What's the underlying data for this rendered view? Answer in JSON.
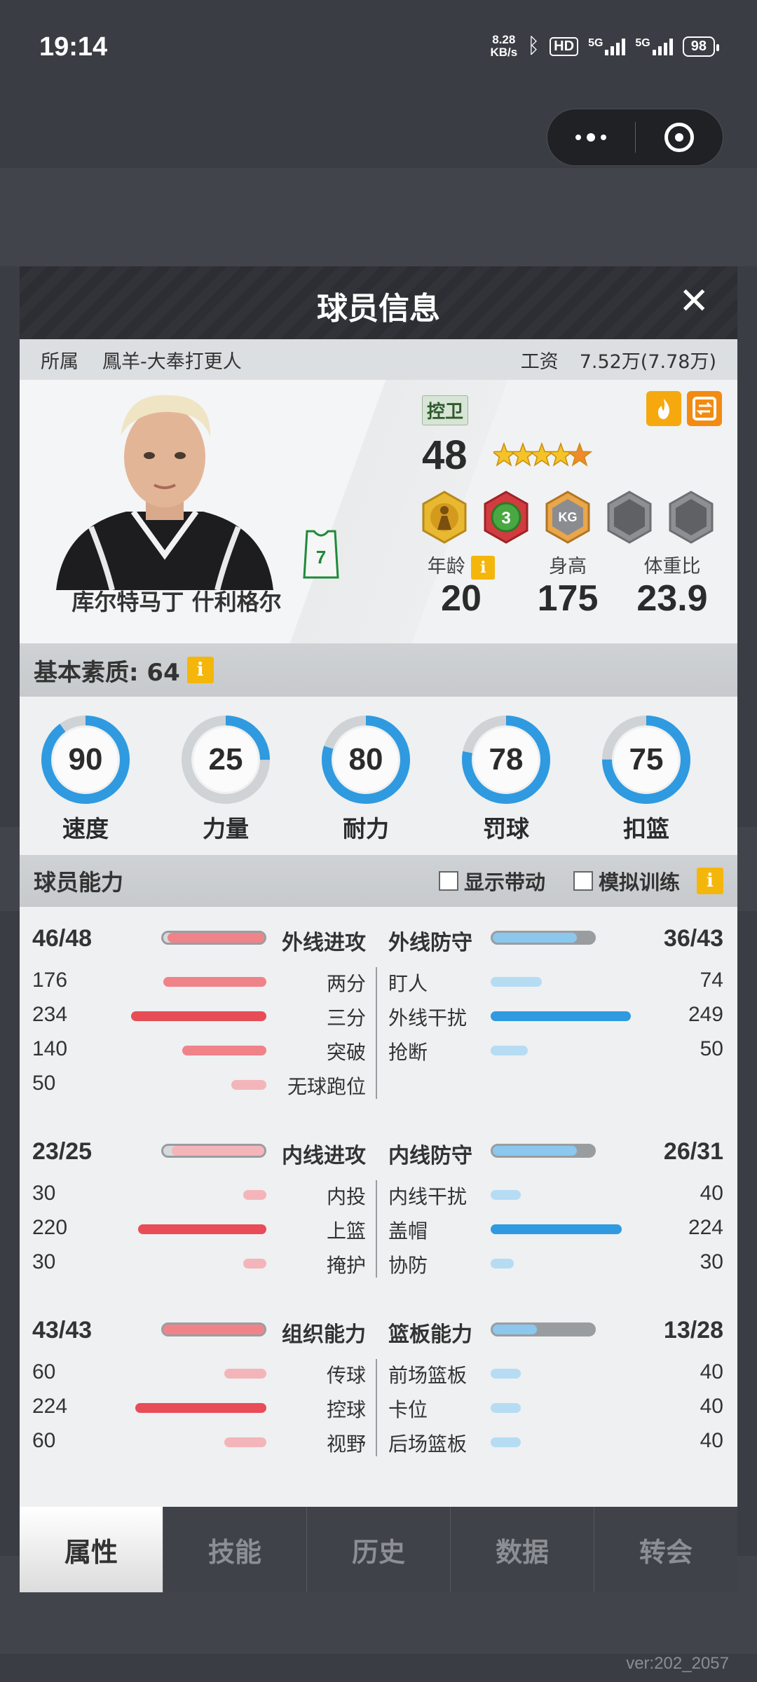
{
  "status_bar": {
    "time": "19:14",
    "net_speed": "8.28",
    "net_unit": "KB/s",
    "battery": "98"
  },
  "modal": {
    "title": "球员信息",
    "close_symbol": "✕",
    "team_label": "所属",
    "team_name": "鳳羊-大奉打更人",
    "salary_label": "工资",
    "salary_value": "7.52万(7.78万)"
  },
  "player": {
    "name": "库尔特马丁 什利格尔",
    "position": "控卫",
    "overall": "48",
    "jersey_number": "7",
    "stars": 4.5,
    "age_label": "年龄",
    "age": "20",
    "height_label": "身高",
    "height": "175",
    "weight_ratio_label": "体重比",
    "weight_ratio": "23.9",
    "badge_3": "3",
    "badge_kg": "KG"
  },
  "basic": {
    "label": "基本素质: 64",
    "info": "i",
    "rings": [
      {
        "label": "速度",
        "value": "90"
      },
      {
        "label": "力量",
        "value": "25"
      },
      {
        "label": "耐力",
        "value": "80"
      },
      {
        "label": "罚球",
        "value": "78"
      },
      {
        "label": "扣篮",
        "value": "75"
      }
    ]
  },
  "ability": {
    "label": "球员能力",
    "show_drive": "显示带动",
    "sim_training": "模拟训练",
    "info": "i",
    "groups": [
      {
        "left_head": {
          "value": "46/48",
          "name": "外线进攻",
          "fill": 0.96
        },
        "right_head": {
          "value": "36/43",
          "name": "外线防守",
          "fill": 0.84
        },
        "left": [
          {
            "value": "176",
            "name": "两分",
            "fill": 0.44
          },
          {
            "value": "234",
            "name": "三分",
            "fill": 0.58
          },
          {
            "value": "140",
            "name": "突破",
            "fill": 0.36
          },
          {
            "value": "50",
            "name": "无球跑位",
            "fill": 0.15
          }
        ],
        "right": [
          {
            "value": "74",
            "name": "盯人",
            "fill": 0.22
          },
          {
            "value": "249",
            "name": "外线干扰",
            "fill": 0.62
          },
          {
            "value": "50",
            "name": "抢断",
            "fill": 0.16
          }
        ]
      },
      {
        "left_head": {
          "value": "23/25",
          "name": "内线进攻",
          "fill": 0.92
        },
        "right_head": {
          "value": "26/31",
          "name": "内线防守",
          "fill": 0.84
        },
        "left": [
          {
            "value": "30",
            "name": "内投",
            "fill": 0.1
          },
          {
            "value": "220",
            "name": "上篮",
            "fill": 0.55
          },
          {
            "value": "30",
            "name": "掩护",
            "fill": 0.1
          }
        ],
        "right": [
          {
            "value": "40",
            "name": "内线干扰",
            "fill": 0.13
          },
          {
            "value": "224",
            "name": "盖帽",
            "fill": 0.56
          },
          {
            "value": "30",
            "name": "协防",
            "fill": 0.1
          }
        ]
      },
      {
        "left_head": {
          "value": "43/43",
          "name": "组织能力",
          "fill": 1.0
        },
        "right_head": {
          "value": "13/28",
          "name": "篮板能力",
          "fill": 0.46
        },
        "left": [
          {
            "value": "60",
            "name": "传球",
            "fill": 0.18
          },
          {
            "value": "224",
            "name": "控球",
            "fill": 0.56
          },
          {
            "value": "60",
            "name": "视野",
            "fill": 0.18
          }
        ],
        "right": [
          {
            "value": "40",
            "name": "前场篮板",
            "fill": 0.13
          },
          {
            "value": "40",
            "name": "卡位",
            "fill": 0.13
          },
          {
            "value": "40",
            "name": "后场篮板",
            "fill": 0.13
          }
        ]
      }
    ]
  },
  "tabs": [
    "属性",
    "技能",
    "历史",
    "数据",
    "转会"
  ],
  "active_tab": 0,
  "version": "ver:202_2057",
  "colors": {
    "accent_red": "#e84c56",
    "accent_blue": "#2f9ae0",
    "info_yellow": "#f5b60c"
  }
}
